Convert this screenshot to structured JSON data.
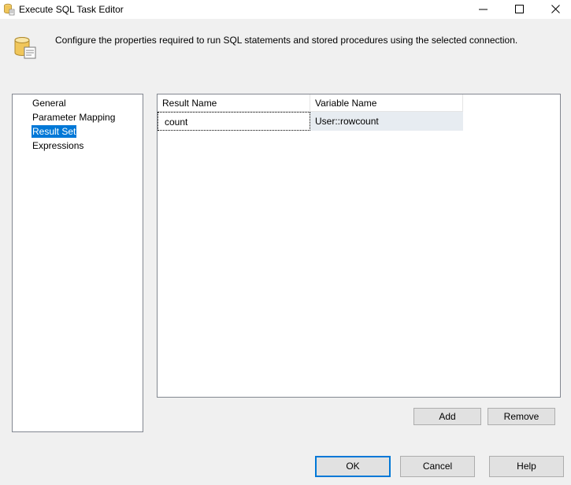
{
  "window": {
    "title": "Execute SQL Task Editor",
    "icon": "sql-task-icon"
  },
  "header": {
    "description": "Configure the properties required to run SQL statements and stored procedures using the selected connection.",
    "icon": "database-page-icon"
  },
  "nav": {
    "items": [
      {
        "label": "General",
        "selected": false
      },
      {
        "label": "Parameter Mapping",
        "selected": false
      },
      {
        "label": "Result Set",
        "selected": true
      },
      {
        "label": "Expressions",
        "selected": false
      }
    ]
  },
  "result_grid": {
    "columns": [
      "Result Name",
      "Variable Name"
    ],
    "rows": [
      {
        "result_name": "count",
        "variable_name": "User::rowcount"
      }
    ]
  },
  "buttons": {
    "add": "Add",
    "remove": "Remove",
    "ok": "OK",
    "cancel": "Cancel",
    "help": "Help"
  },
  "colors": {
    "selection": "#0078d7",
    "dialog_bg": "#f0f0f0",
    "row_highlight": "#e7ecf1"
  }
}
